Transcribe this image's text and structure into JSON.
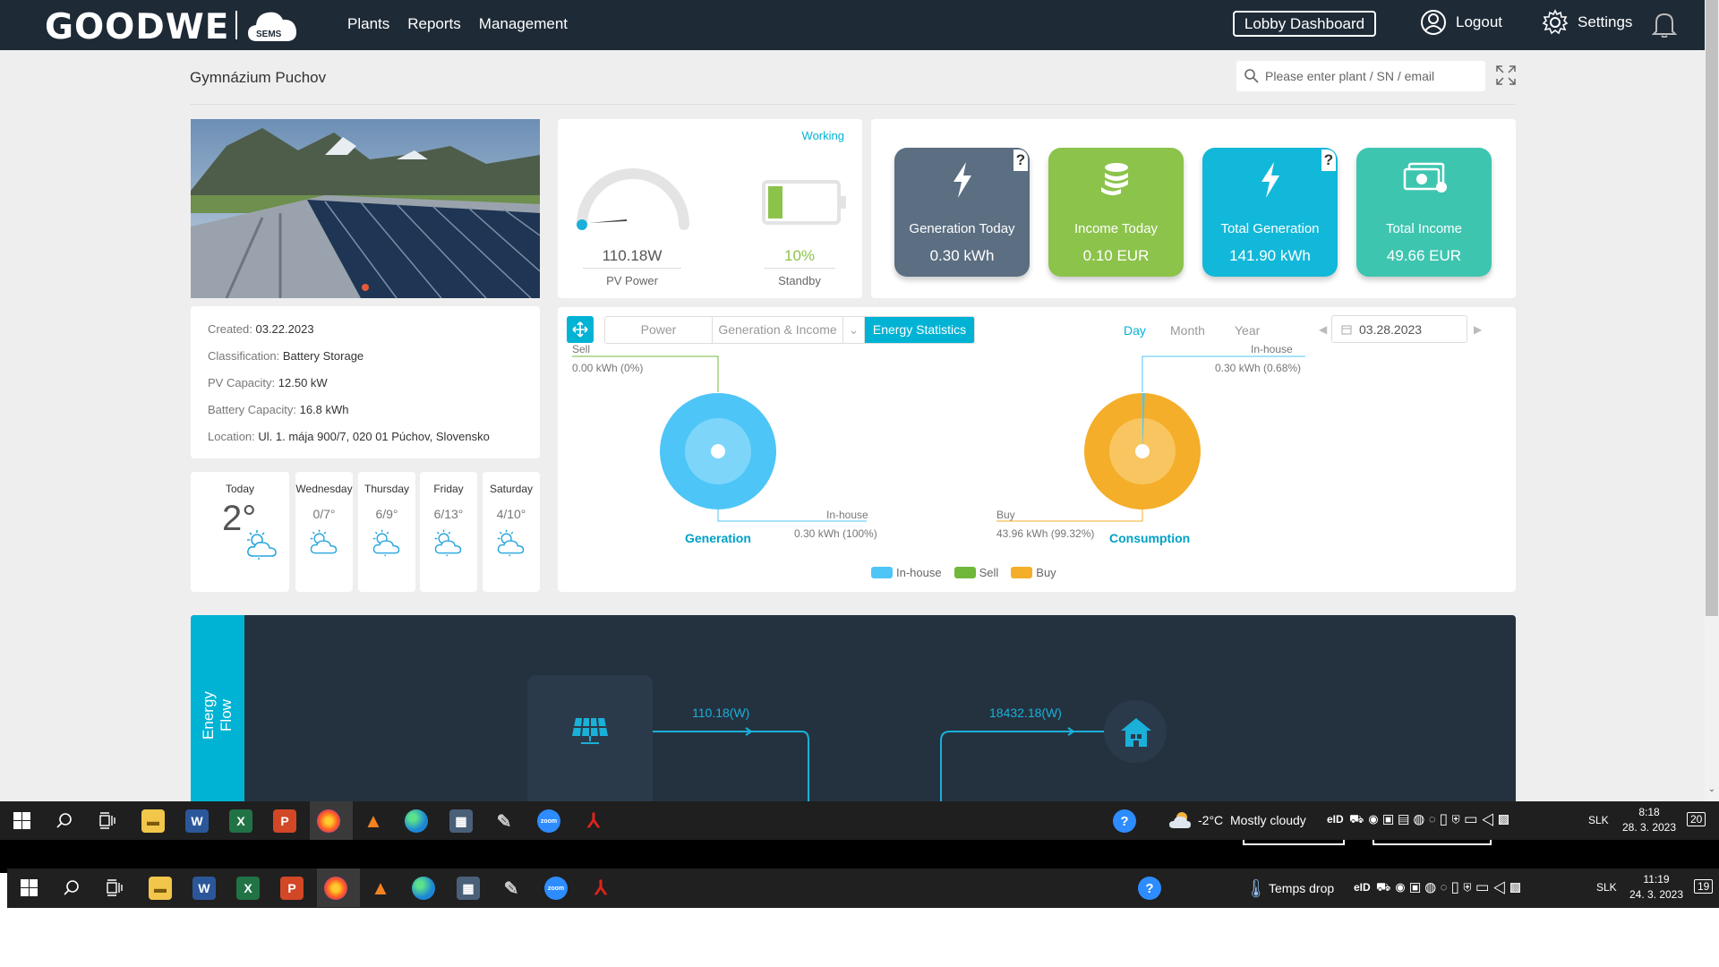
{
  "nav": {
    "logo": "GOODWE",
    "logo_sub": "SEMS",
    "menu": [
      "Plants",
      "Reports",
      "Management"
    ],
    "lobby_dashboard": "Lobby Dashboard",
    "logout": "Logout",
    "settings": "Settings"
  },
  "page": {
    "title": "Gymnázium Puchov",
    "search_placeholder": "Please enter plant / SN / email"
  },
  "plant_info": [
    {
      "key": "Created",
      "value": "03.22.2023"
    },
    {
      "key": "Classification",
      "value": "Battery Storage"
    },
    {
      "key": "PV Capacity",
      "value": "12.50 kW"
    },
    {
      "key": "Battery Capacity",
      "value": "16.8 kWh"
    },
    {
      "key": "Location",
      "value": "Ul. 1. mája 900/7, 020 01 Púchov, Slovensko"
    }
  ],
  "weather": [
    {
      "day": "Today",
      "temp": "2°"
    },
    {
      "day": "Wednesday",
      "temp": "0/7°"
    },
    {
      "day": "Thursday",
      "temp": "6/9°"
    },
    {
      "day": "Friday",
      "temp": "6/13°"
    },
    {
      "day": "Saturday",
      "temp": "4/10°"
    }
  ],
  "status": {
    "state": "Working",
    "pv_power_value": "110.18W",
    "pv_power_label": "PV Power",
    "battery_percent": "10%",
    "battery_fraction": 0.1,
    "battery_label": "Standby"
  },
  "stats": [
    {
      "label": "Generation Today",
      "value": "0.30 kWh",
      "color": "#5b6e82",
      "help": "?",
      "icon": "bolt-icon"
    },
    {
      "label": "Income Today",
      "value": "0.10 EUR",
      "color": "#8cc34b",
      "help": "",
      "icon": "coins-icon"
    },
    {
      "label": "Total Generation",
      "value": "141.90 kWh",
      "color": "#12b8d9",
      "help": "?",
      "icon": "bolt-icon"
    },
    {
      "label": "Total Income",
      "value": "49.66 EUR",
      "color": "#3ec5b0",
      "help": "",
      "icon": "cash-icon"
    }
  ],
  "chart_tabs": [
    "Power",
    "Generation & Income",
    "Energy Statistics"
  ],
  "chart_active_tab": "Energy Statistics",
  "period_tabs": [
    "Day",
    "Month",
    "Year"
  ],
  "period_active": "Day",
  "date": "03.28.2023",
  "colors": {
    "inhouse": "#4ec5f7",
    "sell": "#70b83a",
    "buy": "#f4ae2a",
    "accent": "#00b3d4"
  },
  "chart_data": [
    {
      "type": "pie",
      "title": "Generation",
      "slices": [
        {
          "name": "Sell",
          "value": 0.0,
          "label": "0.00 kWh (0%)"
        },
        {
          "name": "In-house",
          "value": 0.3,
          "label": "0.30 kWh (100%)"
        }
      ]
    },
    {
      "type": "pie",
      "title": "Consumption",
      "slices": [
        {
          "name": "In-house",
          "value": 0.3,
          "label": "0.30 kWh (0.68%)"
        },
        {
          "name": "Buy",
          "value": 43.96,
          "label": "43.96 kWh (99.32%)"
        }
      ]
    }
  ],
  "legend": [
    "In-house",
    "Sell",
    "Buy"
  ],
  "energy_flow": {
    "title": "Energy Flow",
    "pv_flow": "110.18(W)",
    "load_flow": "18432.18(W)"
  },
  "taskbar1": {
    "weather_temp": "-2°C",
    "weather_text": "Mostly cloudy",
    "lang": "SLK",
    "eid": "eID",
    "time": "8:18",
    "date": "28. 3. 2023",
    "notifications": "20"
  },
  "taskbar2": {
    "weather_text": "Temps drop",
    "lang": "SLK",
    "eid": "eID",
    "time": "11:19",
    "date": "24. 3. 2023",
    "notifications": "19"
  },
  "apps": [
    "file-explorer",
    "word",
    "excel",
    "powerpoint",
    "firefox",
    "vlc",
    "edge",
    "calculator",
    "paint",
    "zoom",
    "acrobat"
  ],
  "app_letters": {
    "word": "W",
    "excel": "X",
    "powerpoint": "P",
    "zoom": "zoom"
  }
}
